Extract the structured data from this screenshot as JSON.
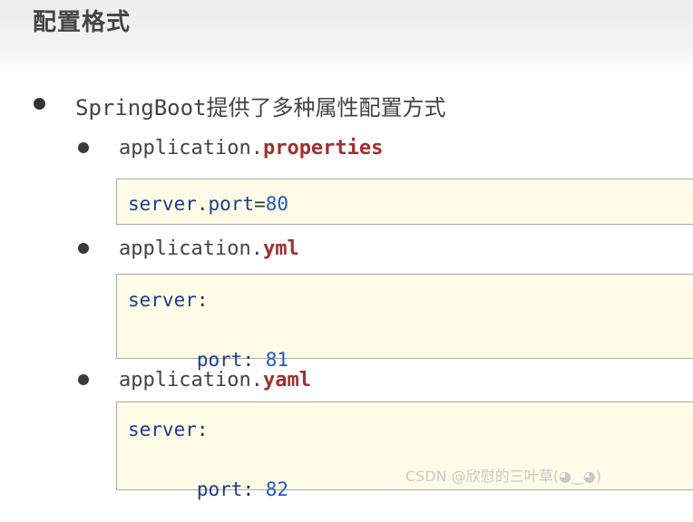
{
  "page": {
    "title": "配置格式",
    "main_point": "SpringBoot提供了多种属性配置方式"
  },
  "configs": [
    {
      "file_base": "application.",
      "file_ext": "properties",
      "lines": [
        {
          "key": "server.port",
          "sep": "=",
          "value": "80"
        }
      ]
    },
    {
      "file_base": "application.",
      "file_ext": "yml",
      "lines": [
        {
          "key": "server",
          "sep": ":",
          "value": ""
        },
        {
          "key": "  port",
          "sep": ": ",
          "value": "81"
        }
      ]
    },
    {
      "file_base": "application.",
      "file_ext": "yaml",
      "lines": [
        {
          "key": "server",
          "sep": ":",
          "value": ""
        },
        {
          "key": "  port",
          "sep": ": ",
          "value": "82"
        }
      ]
    }
  ],
  "watermark": "CSDN @欣慰的三叶草(◕‿◕)",
  "colors": {
    "extension": "#a0302d",
    "code_key": "#1b3d8c",
    "code_value": "#1f57c7",
    "code_background": "#fefce6"
  }
}
